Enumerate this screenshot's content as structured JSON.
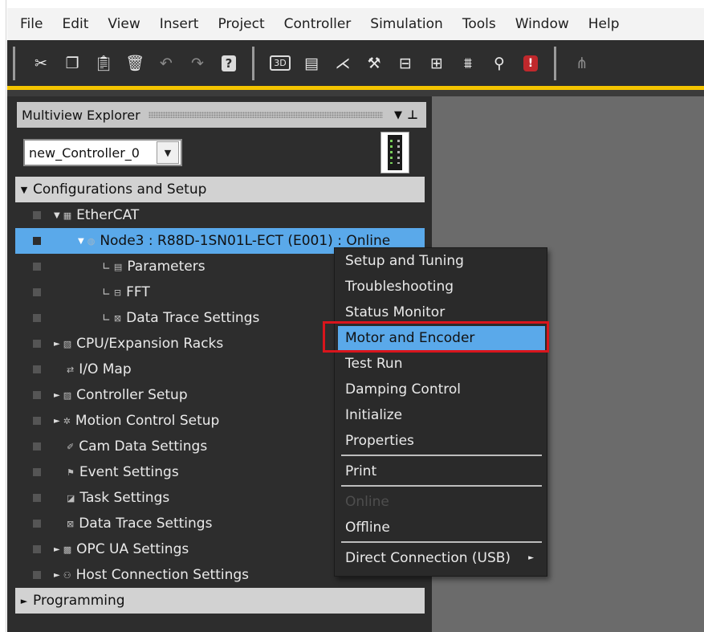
{
  "menubar": {
    "items": [
      "File",
      "Edit",
      "View",
      "Insert",
      "Project",
      "Controller",
      "Simulation",
      "Tools",
      "Window",
      "Help"
    ]
  },
  "toolbar": {
    "groups": [
      [
        "cut-icon",
        "copy-icon",
        "paste-icon",
        "delete-icon",
        "undo-icon",
        "redo-icon",
        "help-icon"
      ],
      [
        "3d-view-icon",
        "layout-icon",
        "build-icon",
        "tools-icon",
        "online-icon",
        "monitor-icon",
        "chart-icon",
        "search-icon",
        "alert-icon"
      ],
      [
        "more-icon"
      ]
    ],
    "labels": {
      "three_d": "3D",
      "help": "?",
      "alert": "!"
    }
  },
  "explorer": {
    "title": "Multiview Explorer",
    "collapse_glyph": "▼",
    "pin_glyph": "⊥",
    "controller_select": {
      "value": "new_Controller_0",
      "arrow": "▼"
    },
    "sections": {
      "config": {
        "arrow": "▼",
        "label": "Configurations and Setup"
      },
      "programming": {
        "arrow": "►",
        "label": "Programming"
      }
    },
    "tree": {
      "ethercat": "EtherCAT",
      "node3": "Node3 : R88D-1SN01L-ECT (E001) : Online",
      "parameters": "Parameters",
      "fft": "FFT",
      "data_trace_child": "Data Trace Settings",
      "cpu_racks": "CPU/Expansion Racks",
      "io_map": "I/O Map",
      "controller_setup": "Controller Setup",
      "motion_control_setup": "Motion Control Setup",
      "cam_data_settings": "Cam Data Settings",
      "event_settings": "Event Settings",
      "task_settings": "Task Settings",
      "data_trace_settings": "Data Trace Settings",
      "opc_ua_settings": "OPC UA Settings",
      "host_connection_settings": "Host Connection Settings"
    }
  },
  "context_menu": {
    "items": {
      "setup_tuning": "Setup and Tuning",
      "troubleshooting": "Troubleshooting",
      "status_monitor": "Status Monitor",
      "motor_encoder": "Motor and Encoder",
      "test_run": "Test Run",
      "damping_control": "Damping Control",
      "initialize": "Initialize",
      "properties": "Properties",
      "print": "Print",
      "online": "Online",
      "offline": "Offline",
      "direct_connection": "Direct Connection (USB)"
    },
    "submenu_arrow": "►",
    "highlighted": "Motor and Encoder"
  },
  "colors": {
    "selection": "#5aa9ea",
    "highlight_box": "#d9151c",
    "toolbar_accent": "#f4c400",
    "panel_bg": "#2d2d2d",
    "workarea_bg": "#6b6b6b"
  }
}
